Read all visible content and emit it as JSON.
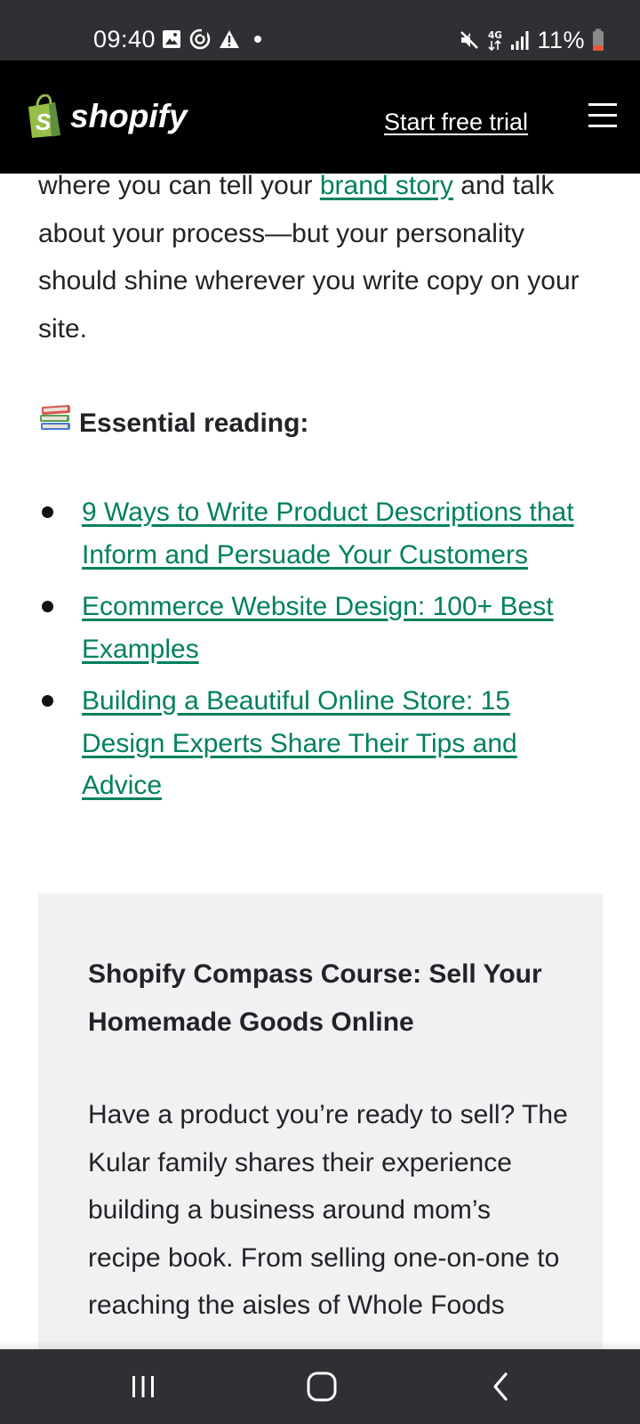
{
  "status_bar": {
    "time": "09:40",
    "battery_percent": "11%",
    "network": "4G",
    "icons_left": [
      "image-icon",
      "sync-icon",
      "warning-icon",
      "dot-icon"
    ],
    "icons_right": [
      "mute-icon",
      "network-4g-icon",
      "signal-icon",
      "battery-icon"
    ]
  },
  "header": {
    "logo_text": "shopify",
    "trial_link": "Start free trial",
    "menu_icon": "hamburger-menu-icon"
  },
  "article": {
    "intro_before_link": "where you can tell your ",
    "intro_link": "brand story",
    "intro_after_link": " and talk about your process—but your personality should shine wherever you write copy on your site.",
    "essential_emoji": "📚",
    "essential_heading": "Essential reading:",
    "reading_list": [
      "9 Ways to Write Product Descriptions that Inform and Persuade Your Customers",
      "Ecommerce Website Design: 100+ Best Examples",
      "Building a Beautiful Online Store: 15 Design Experts Share Their Tips and Advice"
    ]
  },
  "course_card": {
    "title": "Shopify Compass Course: Sell Your Homemade Goods Online",
    "body": "Have a product you’re ready to sell? The Kular family shares their experience building a business around mom’s recipe book. From selling one-on-one to reaching the aisles of Whole Foods"
  },
  "nav_bar": {
    "recents_icon": "recents-icon",
    "home_icon": "home-icon",
    "back_icon": "back-icon"
  },
  "colors": {
    "link_green": "#00805f",
    "header_bg": "#000000",
    "system_bar_bg": "#2f3033",
    "card_bg": "#f0f1f2",
    "body_text": "#212326"
  }
}
